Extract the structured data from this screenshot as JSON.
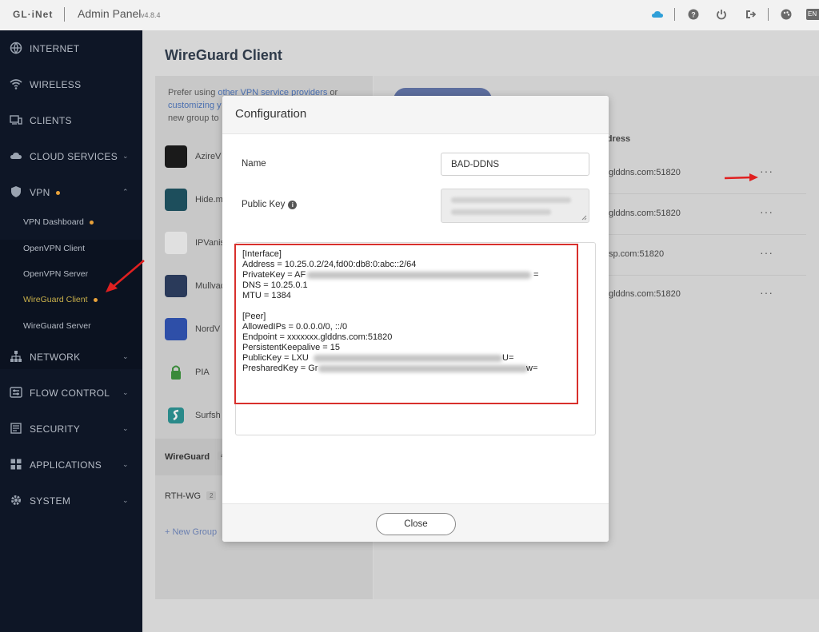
{
  "header": {
    "logo": "GL·iNet",
    "title": "Admin Panel",
    "version": "v4.8.4",
    "lang": "EN"
  },
  "sidebar": {
    "items": [
      {
        "label": "INTERNET",
        "icon": "globe-icon"
      },
      {
        "label": "WIRELESS",
        "icon": "wifi-icon"
      },
      {
        "label": "CLIENTS",
        "icon": "devices-icon"
      },
      {
        "label": "CLOUD SERVICES",
        "icon": "cloud-icon"
      },
      {
        "label": "VPN",
        "icon": "shield-icon"
      },
      {
        "label": "NETWORK",
        "icon": "network-icon"
      },
      {
        "label": "FLOW CONTROL",
        "icon": "flow-icon"
      },
      {
        "label": "SECURITY",
        "icon": "security-icon"
      },
      {
        "label": "APPLICATIONS",
        "icon": "apps-icon"
      },
      {
        "label": "SYSTEM",
        "icon": "gear-icon"
      }
    ],
    "vpn_sub": [
      {
        "label": "VPN Dashboard"
      },
      {
        "label": "OpenVPN Client"
      },
      {
        "label": "OpenVPN Server"
      },
      {
        "label": "WireGuard Client"
      },
      {
        "label": "WireGuard Server"
      }
    ]
  },
  "main": {
    "title": "WireGuard Client",
    "intro": {
      "prefix": "Prefer using ",
      "link1": "other VPN service providers",
      "mid": " or",
      "link2": "customizing y",
      "suffix": "new group to"
    },
    "providers": [
      {
        "name": "AzireV",
        "color": "#1a1a1a"
      },
      {
        "name": "Hide.m",
        "color": "#1d4e5c"
      },
      {
        "name": "IPVanis",
        "color": "#e8e8e8"
      },
      {
        "name": "Mullvac",
        "color": "#2a3a5a"
      },
      {
        "name": "NordV",
        "color": "#2e4fa8"
      },
      {
        "name": "PIA",
        "color": "#c8c8c8"
      },
      {
        "name": "Surfsh",
        "color": "#c8c8c8"
      }
    ],
    "groups": [
      {
        "name": "WireGuard",
        "count": "4"
      },
      {
        "name": "RTH-WG",
        "count": "2"
      }
    ],
    "new_group": "+  New Group",
    "address_header": "ddress",
    "rows": [
      {
        "address": "glddns.com:51820"
      },
      {
        "address": "glddns.com:51820"
      },
      {
        "address": "sp.com:51820"
      },
      {
        "address": "glddns.com:51820"
      }
    ],
    "more_label": "···"
  },
  "modal": {
    "title": "Configuration",
    "name_label": "Name",
    "name_value": "BAD-DDNS",
    "pubkey_label": "Public Key",
    "config_lines": [
      "[Interface]",
      "Address = 10.25.0.2/24,fd00:db8:0:abc::2/64",
      "PrivateKey = AF",
      "DNS = 10.25.0.1",
      "MTU = 1384",
      "",
      "[Peer]",
      "AllowedIPs = 0.0.0.0/0, ::/0",
      "Endpoint = xxxxxxx.glddns.com:51820",
      "PersistentKeepalive = 15",
      "PublicKey = LXU",
      "PresharedKey = Gr"
    ],
    "privkey_tail": "=",
    "pubkey_tail": "U=",
    "psk_tail": "w=",
    "close_label": "Close"
  },
  "colors": {
    "sidebar_bg": "#0e1626",
    "active_item": "#c9b04a",
    "status_dot": "#e8a13a",
    "highlight_border": "#d8302c",
    "annotation_arrow": "#e02020"
  }
}
